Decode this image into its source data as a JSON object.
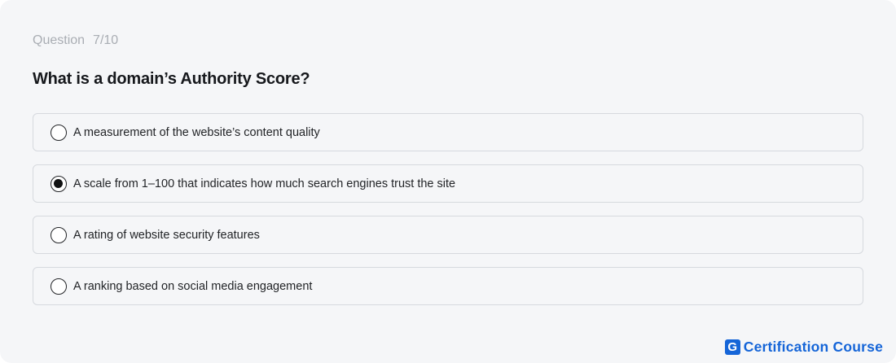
{
  "quiz": {
    "progress_label": "Question",
    "progress_count": "7/10",
    "question": "What is a domain’s Authority Score?",
    "options": [
      {
        "label": "A measurement of the website’s content quality",
        "selected": false
      },
      {
        "label": "A scale from 1–100 that indicates how much search engines trust the site",
        "selected": true
      },
      {
        "label": "A rating of website security features",
        "selected": false
      },
      {
        "label": "A ranking based on social media engagement",
        "selected": false
      }
    ]
  },
  "brand": {
    "logo_letter": "G",
    "text": "Certification Course",
    "color": "#1565d8"
  }
}
